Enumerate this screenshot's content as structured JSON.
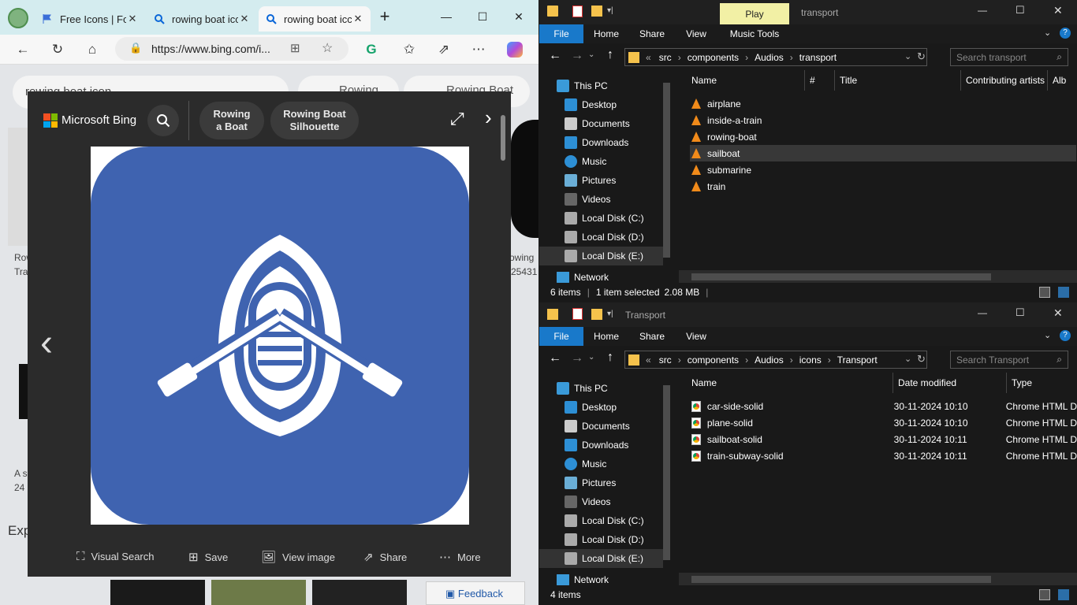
{
  "browser": {
    "tabs": [
      {
        "label": "Free Icons | Fon",
        "icon": "flag-icon"
      },
      {
        "label": "rowing boat icc",
        "icon": "bing-search-icon"
      },
      {
        "label": "rowing boat icc",
        "icon": "bing-search-icon"
      }
    ],
    "new_tab": "+",
    "url": "https://www.bing.com/i...",
    "page_search_query": "rowing boat icon",
    "bg_chips": [
      "Rowing",
      "Rowing Boat"
    ],
    "bg_captions": [
      "Row",
      "Tra",
      "rowing",
      "25431",
      "A s",
      "24",
      "Exp"
    ],
    "feedback": "Feedback"
  },
  "overlay": {
    "brand": "Microsoft Bing",
    "pills": [
      {
        "line1": "Rowing",
        "line2": "a Boat"
      },
      {
        "line1": "Rowing Boat",
        "line2": "Silhouette"
      }
    ],
    "actions": [
      "Visual Search",
      "Save",
      "View image",
      "Share",
      "More"
    ],
    "image_bg_color": "#3f63b0"
  },
  "explorer_top": {
    "title": "transport",
    "context_tab": "Play",
    "ribbon": [
      "File",
      "Home",
      "Share",
      "View",
      "Music Tools"
    ],
    "path": [
      "src",
      "components",
      "Audios",
      "transport"
    ],
    "search_placeholder": "Search transport",
    "nav": [
      "This PC",
      "Desktop",
      "Documents",
      "Downloads",
      "Music",
      "Pictures",
      "Videos",
      "Local Disk (C:)",
      "Local Disk (D:)",
      "Local Disk (E:)",
      "Network"
    ],
    "columns": [
      "Name",
      "#",
      "Title",
      "Contributing artists",
      "Alb"
    ],
    "files": [
      "airplane",
      "inside-a-train",
      "rowing-boat",
      "sailboat",
      "submarine",
      "train"
    ],
    "selected_file": "sailboat",
    "status_items": "6 items",
    "status_selected": "1 item selected",
    "status_size": "2.08 MB"
  },
  "explorer_bottom": {
    "title": "Transport",
    "ribbon": [
      "File",
      "Home",
      "Share",
      "View"
    ],
    "path": [
      "src",
      "components",
      "Audios",
      "icons",
      "Transport"
    ],
    "search_placeholder": "Search Transport",
    "nav": [
      "This PC",
      "Desktop",
      "Documents",
      "Downloads",
      "Music",
      "Pictures",
      "Videos",
      "Local Disk (C:)",
      "Local Disk (D:)",
      "Local Disk (E:)",
      "Network"
    ],
    "columns": [
      "Name",
      "Date modified",
      "Type"
    ],
    "files": [
      {
        "name": "car-side-solid",
        "date": "30-11-2024 10:10",
        "type": "Chrome HTML D"
      },
      {
        "name": "plane-solid",
        "date": "30-11-2024 10:10",
        "type": "Chrome HTML D"
      },
      {
        "name": "sailboat-solid",
        "date": "30-11-2024 10:11",
        "type": "Chrome HTML D"
      },
      {
        "name": "train-subway-solid",
        "date": "30-11-2024 10:11",
        "type": "Chrome HTML D"
      }
    ],
    "status_items": "4 items"
  }
}
